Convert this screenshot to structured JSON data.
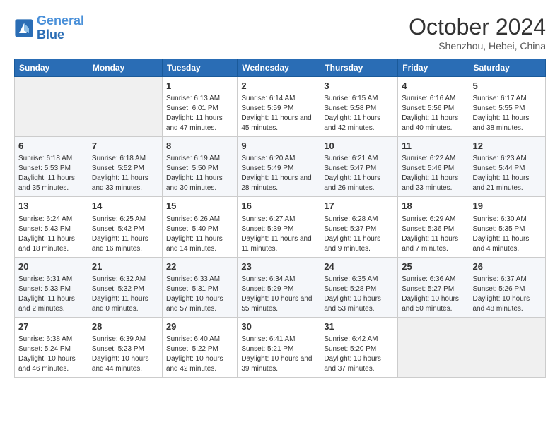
{
  "logo": {
    "line1": "General",
    "line2": "Blue"
  },
  "title": "October 2024",
  "subtitle": "Shenzhou, Hebei, China",
  "headers": [
    "Sunday",
    "Monday",
    "Tuesday",
    "Wednesday",
    "Thursday",
    "Friday",
    "Saturday"
  ],
  "weeks": [
    [
      {
        "day": "",
        "info": ""
      },
      {
        "day": "",
        "info": ""
      },
      {
        "day": "1",
        "info": "Sunrise: 6:13 AM\nSunset: 6:01 PM\nDaylight: 11 hours and 47 minutes."
      },
      {
        "day": "2",
        "info": "Sunrise: 6:14 AM\nSunset: 5:59 PM\nDaylight: 11 hours and 45 minutes."
      },
      {
        "day": "3",
        "info": "Sunrise: 6:15 AM\nSunset: 5:58 PM\nDaylight: 11 hours and 42 minutes."
      },
      {
        "day": "4",
        "info": "Sunrise: 6:16 AM\nSunset: 5:56 PM\nDaylight: 11 hours and 40 minutes."
      },
      {
        "day": "5",
        "info": "Sunrise: 6:17 AM\nSunset: 5:55 PM\nDaylight: 11 hours and 38 minutes."
      }
    ],
    [
      {
        "day": "6",
        "info": "Sunrise: 6:18 AM\nSunset: 5:53 PM\nDaylight: 11 hours and 35 minutes."
      },
      {
        "day": "7",
        "info": "Sunrise: 6:18 AM\nSunset: 5:52 PM\nDaylight: 11 hours and 33 minutes."
      },
      {
        "day": "8",
        "info": "Sunrise: 6:19 AM\nSunset: 5:50 PM\nDaylight: 11 hours and 30 minutes."
      },
      {
        "day": "9",
        "info": "Sunrise: 6:20 AM\nSunset: 5:49 PM\nDaylight: 11 hours and 28 minutes."
      },
      {
        "day": "10",
        "info": "Sunrise: 6:21 AM\nSunset: 5:47 PM\nDaylight: 11 hours and 26 minutes."
      },
      {
        "day": "11",
        "info": "Sunrise: 6:22 AM\nSunset: 5:46 PM\nDaylight: 11 hours and 23 minutes."
      },
      {
        "day": "12",
        "info": "Sunrise: 6:23 AM\nSunset: 5:44 PM\nDaylight: 11 hours and 21 minutes."
      }
    ],
    [
      {
        "day": "13",
        "info": "Sunrise: 6:24 AM\nSunset: 5:43 PM\nDaylight: 11 hours and 18 minutes."
      },
      {
        "day": "14",
        "info": "Sunrise: 6:25 AM\nSunset: 5:42 PM\nDaylight: 11 hours and 16 minutes."
      },
      {
        "day": "15",
        "info": "Sunrise: 6:26 AM\nSunset: 5:40 PM\nDaylight: 11 hours and 14 minutes."
      },
      {
        "day": "16",
        "info": "Sunrise: 6:27 AM\nSunset: 5:39 PM\nDaylight: 11 hours and 11 minutes."
      },
      {
        "day": "17",
        "info": "Sunrise: 6:28 AM\nSunset: 5:37 PM\nDaylight: 11 hours and 9 minutes."
      },
      {
        "day": "18",
        "info": "Sunrise: 6:29 AM\nSunset: 5:36 PM\nDaylight: 11 hours and 7 minutes."
      },
      {
        "day": "19",
        "info": "Sunrise: 6:30 AM\nSunset: 5:35 PM\nDaylight: 11 hours and 4 minutes."
      }
    ],
    [
      {
        "day": "20",
        "info": "Sunrise: 6:31 AM\nSunset: 5:33 PM\nDaylight: 11 hours and 2 minutes."
      },
      {
        "day": "21",
        "info": "Sunrise: 6:32 AM\nSunset: 5:32 PM\nDaylight: 11 hours and 0 minutes."
      },
      {
        "day": "22",
        "info": "Sunrise: 6:33 AM\nSunset: 5:31 PM\nDaylight: 10 hours and 57 minutes."
      },
      {
        "day": "23",
        "info": "Sunrise: 6:34 AM\nSunset: 5:29 PM\nDaylight: 10 hours and 55 minutes."
      },
      {
        "day": "24",
        "info": "Sunrise: 6:35 AM\nSunset: 5:28 PM\nDaylight: 10 hours and 53 minutes."
      },
      {
        "day": "25",
        "info": "Sunrise: 6:36 AM\nSunset: 5:27 PM\nDaylight: 10 hours and 50 minutes."
      },
      {
        "day": "26",
        "info": "Sunrise: 6:37 AM\nSunset: 5:26 PM\nDaylight: 10 hours and 48 minutes."
      }
    ],
    [
      {
        "day": "27",
        "info": "Sunrise: 6:38 AM\nSunset: 5:24 PM\nDaylight: 10 hours and 46 minutes."
      },
      {
        "day": "28",
        "info": "Sunrise: 6:39 AM\nSunset: 5:23 PM\nDaylight: 10 hours and 44 minutes."
      },
      {
        "day": "29",
        "info": "Sunrise: 6:40 AM\nSunset: 5:22 PM\nDaylight: 10 hours and 42 minutes."
      },
      {
        "day": "30",
        "info": "Sunrise: 6:41 AM\nSunset: 5:21 PM\nDaylight: 10 hours and 39 minutes."
      },
      {
        "day": "31",
        "info": "Sunrise: 6:42 AM\nSunset: 5:20 PM\nDaylight: 10 hours and 37 minutes."
      },
      {
        "day": "",
        "info": ""
      },
      {
        "day": "",
        "info": ""
      }
    ]
  ]
}
